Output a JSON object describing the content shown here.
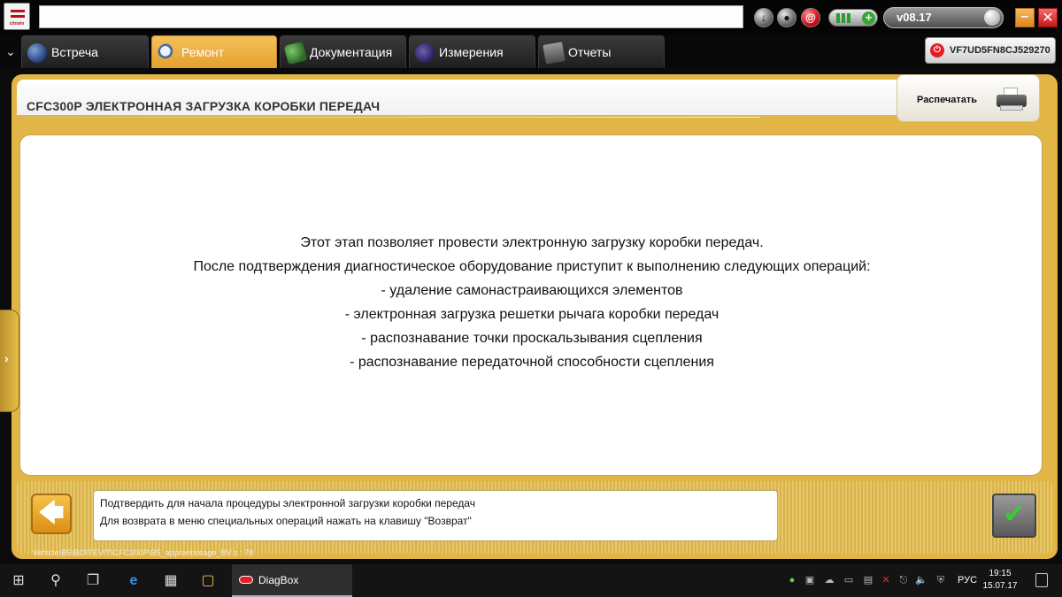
{
  "window": {
    "version": "v08.17",
    "vin": "VF7UD5FN8CJ529270"
  },
  "tabs": [
    {
      "label": "Встреча",
      "icon": "globe-icon",
      "active": false
    },
    {
      "label": "Ремонт",
      "icon": "magnifier-icon",
      "active": true
    },
    {
      "label": "Документация",
      "icon": "book-icon",
      "active": false
    },
    {
      "label": "Измерения",
      "icon": "waveform-icon",
      "active": false
    },
    {
      "label": "Отчеты",
      "icon": "report-icon",
      "active": false
    }
  ],
  "page": {
    "title": "CFC300P  ЭЛЕКТРОННАЯ ЗАГРУЗКА КОРОБКИ ПЕРЕДАЧ",
    "print_label": "Распечатать",
    "message": [
      "Этот этап позволяет провести электронную загрузку коробки передач.",
      "После подтверждения диагностическое оборудование приступит к выполнению следующих операций:",
      "- удаление самонастраивающихся элементов",
      "- электронная загрузка решетки рычага коробки передач",
      "- распознавание точки проскальзывания сцепления",
      "- распознавание передаточной способности сцепления"
    ]
  },
  "footer": {
    "info": [
      "Подтвердить для начала процедуры электронной загрузки коробки передач",
      "Для возврата в меню специальных операций нажать на клавишу \"Возврат\""
    ],
    "path": "Vehicle\\B5\\BOITEVIT\\CFC300P\\B5_apprentissage_BV.s : 78"
  },
  "taskbar": {
    "app_label": "DiagBox",
    "language": "РУС",
    "time": "19:15",
    "date": "15.07.17"
  },
  "colors": {
    "accent": "#e2b646",
    "active_tab": "#f0b84a",
    "alert_red": "#e31e24",
    "ok_green": "#3ec63a"
  }
}
